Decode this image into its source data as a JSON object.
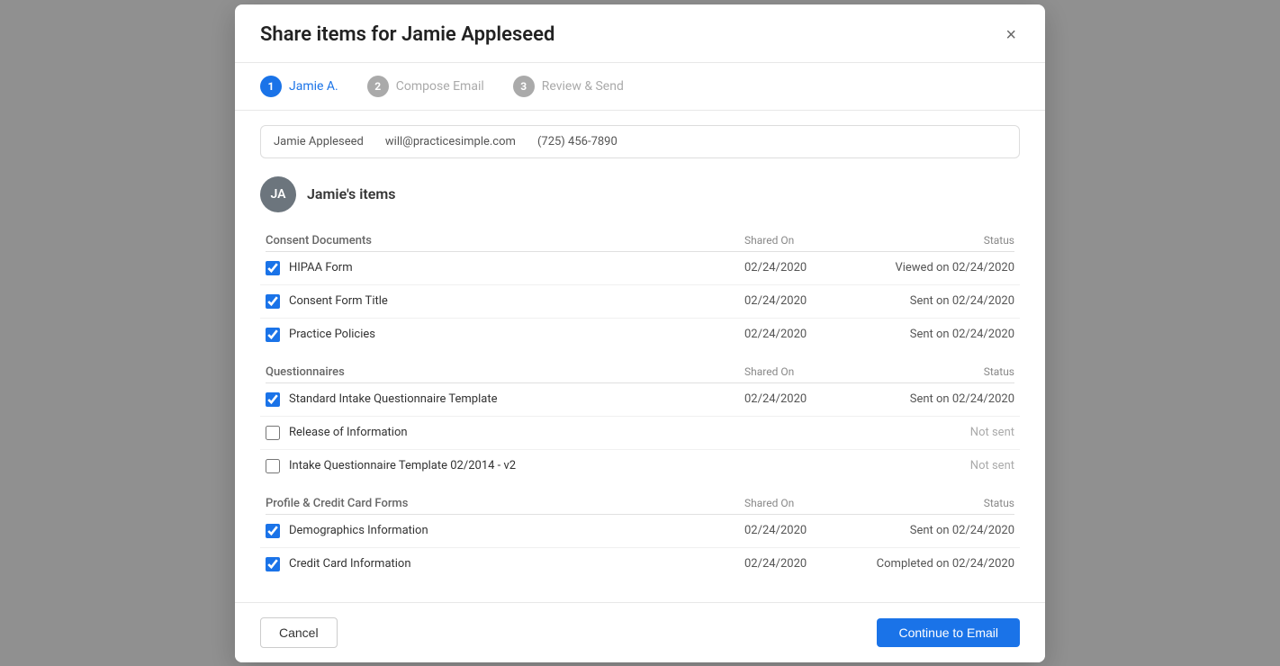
{
  "modal": {
    "title": "Share items for Jamie Appleseed",
    "close_label": "×"
  },
  "stepper": {
    "steps": [
      {
        "number": "1",
        "label": "Jamie A.",
        "active": true
      },
      {
        "number": "2",
        "label": "Compose Email",
        "active": false
      },
      {
        "number": "3",
        "label": "Review & Send",
        "active": false
      }
    ]
  },
  "patient": {
    "name": "Jamie Appleseed",
    "email": "will@practicesimple.com",
    "phone": "(725) 456-7890"
  },
  "items_section": {
    "avatar": "JA",
    "title": "Jamie's items"
  },
  "groups": [
    {
      "id": "consent",
      "label": "Consent Documents",
      "col_shared": "Shared On",
      "col_status": "Status",
      "items": [
        {
          "name": "HIPAA Form",
          "checked": true,
          "date": "02/24/2020",
          "status": "Viewed on 02/24/2020",
          "not_sent": false
        },
        {
          "name": "Consent Form Title",
          "checked": true,
          "date": "02/24/2020",
          "status": "Sent on 02/24/2020",
          "not_sent": false
        },
        {
          "name": "Practice Policies",
          "checked": true,
          "date": "02/24/2020",
          "status": "Sent on 02/24/2020",
          "not_sent": false
        }
      ]
    },
    {
      "id": "questionnaires",
      "label": "Questionnaires",
      "col_shared": "Shared On",
      "col_status": "Status",
      "items": [
        {
          "name": "Standard Intake Questionnaire Template",
          "checked": true,
          "date": "02/24/2020",
          "status": "Sent on 02/24/2020",
          "not_sent": false
        },
        {
          "name": "Release of Information",
          "checked": false,
          "date": "",
          "status": "Not sent",
          "not_sent": true
        },
        {
          "name": "Intake Questionnaire Template 02/2014 - v2",
          "checked": false,
          "date": "",
          "status": "Not sent",
          "not_sent": true
        }
      ]
    },
    {
      "id": "profile",
      "label": "Profile & Credit Card Forms",
      "col_shared": "Shared On",
      "col_status": "Status",
      "items": [
        {
          "name": "Demographics Information",
          "checked": true,
          "date": "02/24/2020",
          "status": "Sent on 02/24/2020",
          "not_sent": false
        },
        {
          "name": "Credit Card Information",
          "checked": true,
          "date": "02/24/2020",
          "status": "Completed on 02/24/2020",
          "not_sent": false,
          "has_arrow": true
        }
      ]
    }
  ],
  "footer": {
    "cancel_label": "Cancel",
    "continue_label": "Continue to Email"
  }
}
